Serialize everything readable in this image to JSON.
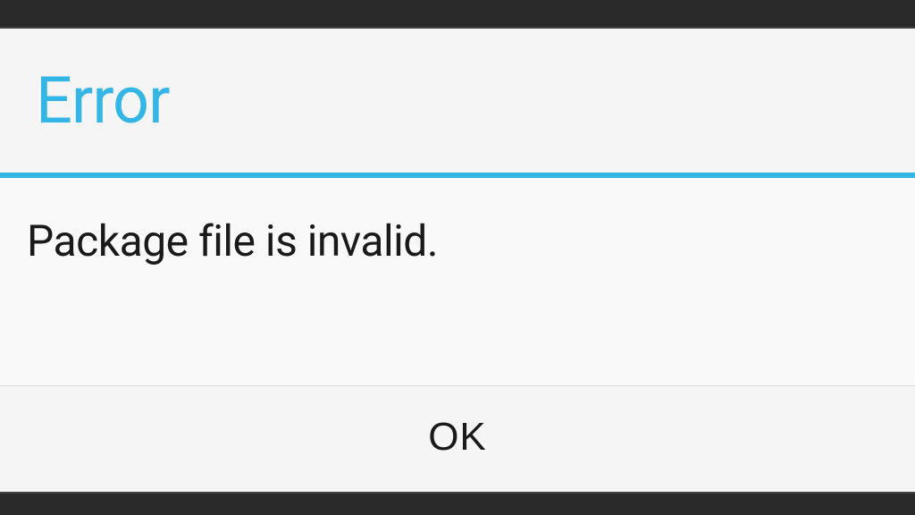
{
  "dialog": {
    "title": "Error",
    "message": "Package file is invalid.",
    "ok_label": "OK"
  },
  "colors": {
    "accent": "#33b5e5",
    "text_primary": "#1a1a1a",
    "background": "#f5f5f5",
    "status_bar": "#2a2a2a"
  }
}
